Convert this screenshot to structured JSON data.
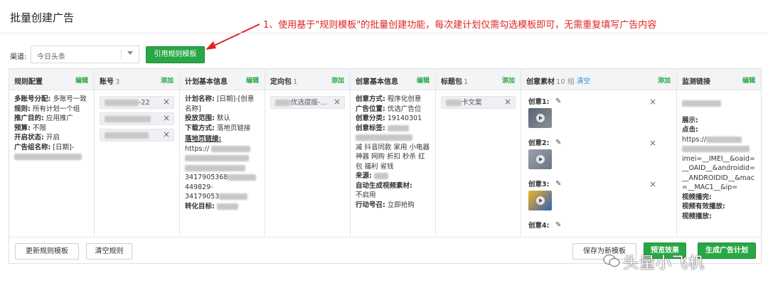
{
  "page": {
    "title": "批量创建广告"
  },
  "annotation": {
    "text": "1、使用基于\"规则模板\"的批量创建功能，每次建计划仅需勾选模板即可，无需重复填写广告内容"
  },
  "channel": {
    "label": "渠道:",
    "value": "今日头条"
  },
  "apply_template_button": "引用规则模板",
  "columns": {
    "rule": {
      "title": "规则配置",
      "action": "编辑",
      "lines": [
        {
          "k": "多账号分配:",
          "v": "多账号一致"
        },
        {
          "k": "规则:",
          "v": "所有计划一个组"
        },
        {
          "k": "推广目的:",
          "v": "应用推广"
        },
        {
          "k": "预算:",
          "v": "不限"
        },
        {
          "k": "开启状态:",
          "v": "开启"
        },
        {
          "k": "广告组名称:",
          "v": "[日期]-"
        }
      ]
    },
    "account": {
      "title": "账号",
      "count": "3",
      "action": "添加",
      "items": [
        {
          "suffix": "-22"
        },
        {
          "suffix": ""
        },
        {
          "suffix": ""
        }
      ]
    },
    "plan": {
      "title": "计划基本信息",
      "action": "编辑",
      "name_k": "计划名称:",
      "name_v": "[日期]-[创意名称]",
      "range_k": "投放范围:",
      "range_v": "默认",
      "download_k": "下载方式:",
      "download_v": "落地页链接",
      "landing_k": "落地页链接:",
      "landing_v1": "https://",
      "num1": "3417905368",
      "num2": "449829-",
      "num3": "34179053",
      "convert_k": "转化目标:"
    },
    "targeting": {
      "title": "定向包",
      "count": "1",
      "action": "添加",
      "item": "优选提版-..."
    },
    "creative_info": {
      "title": "创意基本信息",
      "action": "编辑",
      "method_k": "创意方式:",
      "method_v": "程序化创意",
      "position_k": "广告位置:",
      "position_v": "优选广告位",
      "category_k": "创意分类:",
      "category_v": "19140301",
      "tags_k": "创意标签:",
      "tags_v": "减 抖音同款 家用 小电器 神器 网购 折扣 秒杀 红包 福利 省钱",
      "source_k": "来源:",
      "auto_k": "自动生成视频素材:",
      "auto_v": "不启用",
      "action_k": "行动号召:",
      "action_v": "立即抢购"
    },
    "title_pack": {
      "title": "标题包",
      "count": "1",
      "action": "添加",
      "item": "卡文案"
    },
    "materials": {
      "title": "创意素材",
      "count": "10 组",
      "clear": "清空",
      "action": "添加",
      "items": [
        {
          "label": "创意1:"
        },
        {
          "label": "创意2:"
        },
        {
          "label": "创意3:"
        },
        {
          "label": "创意4:"
        }
      ]
    },
    "tracking": {
      "title": "监测链接",
      "action": "编辑",
      "show_k": "展示:",
      "click_k": "点击:",
      "url_start": "https://",
      "url_params": "imei=__IMEI__&oaid=__OAID__&androidid=__ANDROIDID__&mac=__MAC1__&ip=",
      "video_done_k": "视频播完:",
      "video_valid_k": "视频有效播放:",
      "video_play_k": "视频播放:"
    }
  },
  "footer": {
    "update_template": "更新规则模板",
    "clear_rules": "清空规则",
    "save_as_new": "保存为新模板",
    "preview": "预览效果",
    "generate_plan": "生成广告计划"
  },
  "watermark": "头量小飞机",
  "colors": {
    "green": "#28a745",
    "red_annotation": "#e02424",
    "link_blue": "#1e88e5"
  }
}
